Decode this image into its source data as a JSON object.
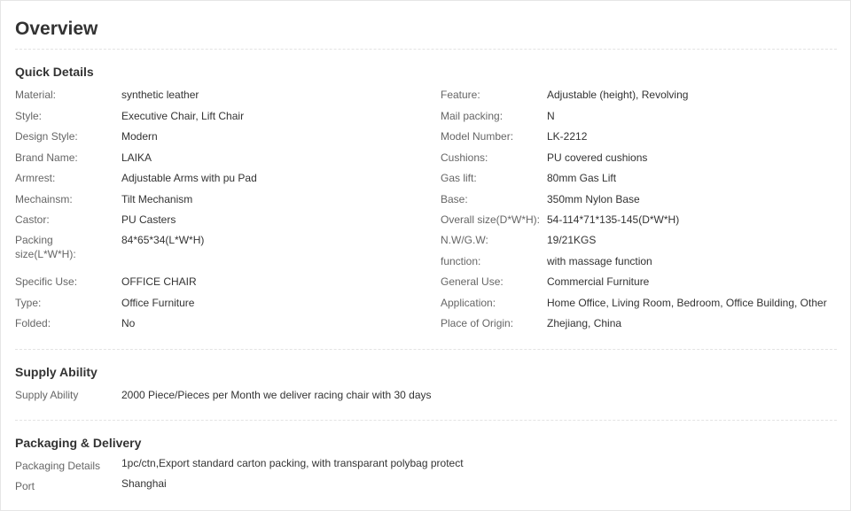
{
  "overview": {
    "title": "Overview"
  },
  "quick_details": {
    "title": "Quick Details",
    "left": [
      {
        "label": "Material:",
        "value": "synthetic leather"
      },
      {
        "label": "Style:",
        "value": "Executive Chair, Lift Chair"
      },
      {
        "label": "Design Style:",
        "value": "Modern"
      },
      {
        "label": "Brand Name:",
        "value": "LAIKA"
      },
      {
        "label": "Armrest:",
        "value": "Adjustable Arms with pu Pad"
      },
      {
        "label": "Mechainsm:",
        "value": "Tilt Mechanism"
      },
      {
        "label": "Castor:",
        "value": "PU Casters"
      },
      {
        "label": "Packing size(L*W*H):",
        "value": "84*65*34(L*W*H)"
      },
      {
        "label": "Specific Use:",
        "value": "OFFICE CHAIR"
      },
      {
        "label": "Type:",
        "value": "Office Furniture"
      },
      {
        "label": "Folded:",
        "value": "No"
      }
    ],
    "right": [
      {
        "label": "Feature:",
        "value": "Adjustable (height), Revolving"
      },
      {
        "label": "Mail packing:",
        "value": "N"
      },
      {
        "label": "Model Number:",
        "value": "LK-2212"
      },
      {
        "label": "Cushions:",
        "value": "PU covered cushions"
      },
      {
        "label": "Gas lift:",
        "value": "80mm Gas Lift"
      },
      {
        "label": "Base:",
        "value": "350mm Nylon Base"
      },
      {
        "label": "Overall size(D*W*H):",
        "value": "54-114*71*135-145(D*W*H)"
      },
      {
        "label": "N.W/G.W:",
        "value": "19/21KGS"
      },
      {
        "label": "function:",
        "value": "with massage function"
      },
      {
        "label": "General Use:",
        "value": "Commercial Furniture"
      },
      {
        "label": "Application:",
        "value": "Home Office, Living Room, Bedroom, Office Building, Other"
      },
      {
        "label": "Place of Origin:",
        "value": "Zhejiang, China"
      }
    ]
  },
  "supply_ability": {
    "title": "Supply Ability",
    "rows": [
      {
        "label": "Supply Ability",
        "value": "2000 Piece/Pieces per Month we deliver racing chair with 30 days"
      }
    ]
  },
  "packaging_delivery": {
    "title": "Packaging & Delivery",
    "rows": [
      {
        "label": "Packaging Details",
        "value": "1pc/ctn,Export standard carton packing, with transparant polybag protect"
      },
      {
        "label": "Port",
        "value": "Shanghai"
      }
    ]
  }
}
